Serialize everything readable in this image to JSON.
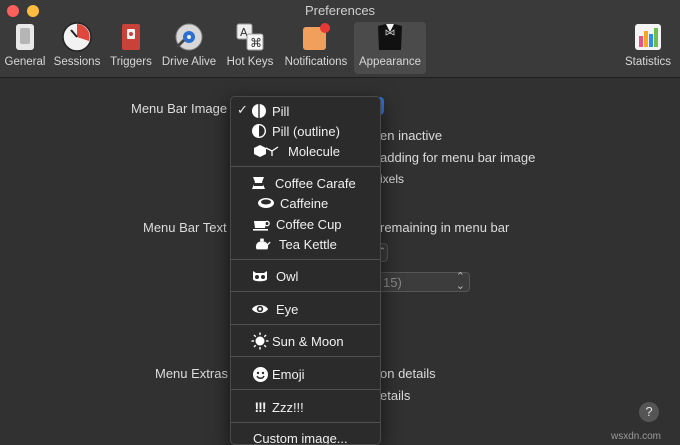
{
  "window": {
    "title": "Preferences"
  },
  "toolbar": {
    "tabs": [
      {
        "label": "General"
      },
      {
        "label": "Sessions"
      },
      {
        "label": "Triggers"
      },
      {
        "label": "Drive Alive"
      },
      {
        "label": "Hot Keys"
      },
      {
        "label": "Notifications"
      },
      {
        "label": "Appearance"
      },
      {
        "label": "Statistics"
      }
    ]
  },
  "content": {
    "menu_bar_image_label": "Menu Bar Image",
    "menu_bar_text_label": "Menu Bar Text",
    "menu_extras_label": "Menu Extras",
    "frag_when_inactive": "en inactive",
    "frag_padding": "adding for menu bar image",
    "frag_pixels": "ixels",
    "frag_remaining": "remaining in menu bar",
    "frag_popup_value": "15)",
    "frag_details1": "on details",
    "frag_details2": "etails",
    "help": "?"
  },
  "menu": {
    "items": [
      {
        "label": "Pill",
        "icon": "pill-icon",
        "checked": true
      },
      {
        "label": "Pill (outline)",
        "icon": "pill-outline-icon"
      },
      {
        "label": "Molecule",
        "icon": "molecule-icon"
      },
      {
        "label": "Coffee Carafe",
        "icon": "coffee-carafe-icon"
      },
      {
        "label": "Caffeine",
        "icon": "caffeine-icon"
      },
      {
        "label": "Coffee Cup",
        "icon": "coffee-cup-icon"
      },
      {
        "label": "Tea Kettle",
        "icon": "tea-kettle-icon"
      },
      {
        "label": "Owl",
        "icon": "owl-icon"
      },
      {
        "label": "Eye",
        "icon": "eye-icon"
      },
      {
        "label": "Sun & Moon",
        "icon": "sun-moon-icon"
      },
      {
        "label": "Emoji",
        "icon": "emoji-icon"
      },
      {
        "label": "Zzz!!!",
        "icon": "exclamation-icon"
      },
      {
        "label": "Custom image..."
      }
    ],
    "checkmark": "✓"
  },
  "watermark": "wsxdn.com"
}
